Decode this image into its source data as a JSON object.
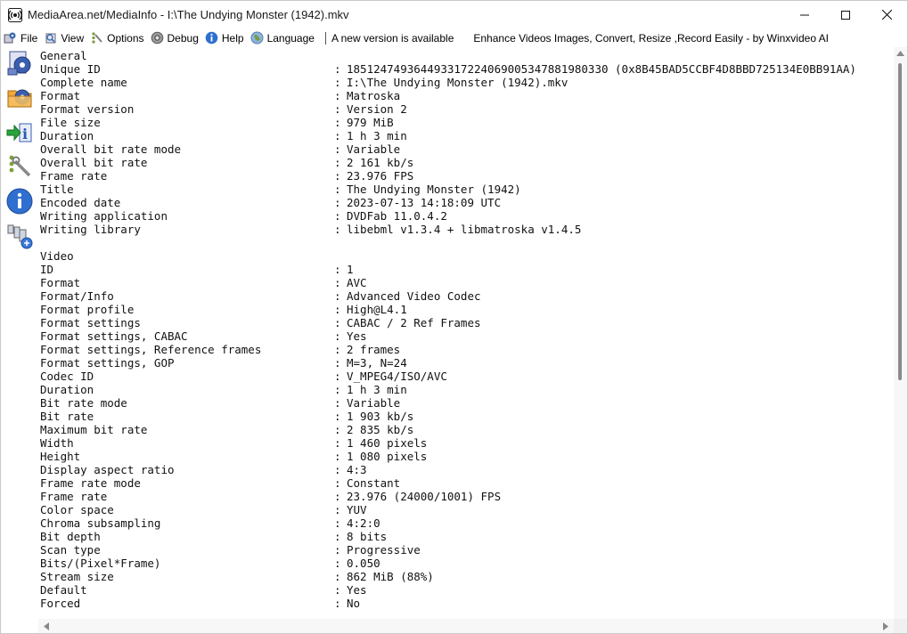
{
  "window": {
    "title": "MediaArea.net/MediaInfo - I:\\The Undying Monster (1942).mkv"
  },
  "menu": {
    "file": "File",
    "view": "View",
    "options": "Options",
    "debug": "Debug",
    "help": "Help",
    "language": "Language",
    "new_version": "A new version is available",
    "promo": "Enhance Videos  Images, Convert, Resize ,Record Easily - by Winxvideo AI"
  },
  "toolbar": {
    "icons": [
      "open-file-icon",
      "open-folder-icon",
      "export-icon",
      "preferences-icon",
      "about-icon",
      "knowledge-base-icon"
    ]
  },
  "general": {
    "heading": "General",
    "rows": [
      {
        "k": "Unique ID",
        "v": "185124749364493317224069005347881980330 (0x8B45BAD5CCBF4D8BBD725134E0BB91AA)"
      },
      {
        "k": "Complete name",
        "v": "I:\\The Undying Monster (1942).mkv"
      },
      {
        "k": "Format",
        "v": "Matroska"
      },
      {
        "k": "Format version",
        "v": "Version 2"
      },
      {
        "k": "File size",
        "v": "979 MiB"
      },
      {
        "k": "Duration",
        "v": "1 h 3 min"
      },
      {
        "k": "Overall bit rate mode",
        "v": "Variable"
      },
      {
        "k": "Overall bit rate",
        "v": "2 161 kb/s"
      },
      {
        "k": "Frame rate",
        "v": "23.976 FPS"
      },
      {
        "k": "Title",
        "v": "The Undying Monster (1942)"
      },
      {
        "k": "Encoded date",
        "v": "2023-07-13 14:18:09 UTC"
      },
      {
        "k": "Writing application",
        "v": "DVDFab 11.0.4.2"
      },
      {
        "k": "Writing library",
        "v": "libebml v1.3.4 + libmatroska v1.4.5"
      }
    ]
  },
  "video": {
    "heading": "Video",
    "rows": [
      {
        "k": "ID",
        "v": "1"
      },
      {
        "k": "Format",
        "v": "AVC"
      },
      {
        "k": "Format/Info",
        "v": "Advanced Video Codec"
      },
      {
        "k": "Format profile",
        "v": "High@L4.1"
      },
      {
        "k": "Format settings",
        "v": "CABAC / 2 Ref Frames"
      },
      {
        "k": "Format settings, CABAC",
        "v": "Yes"
      },
      {
        "k": "Format settings, Reference frames",
        "v": "2 frames"
      },
      {
        "k": "Format settings, GOP",
        "v": "M=3, N=24"
      },
      {
        "k": "Codec ID",
        "v": "V_MPEG4/ISO/AVC"
      },
      {
        "k": "Duration",
        "v": "1 h 3 min"
      },
      {
        "k": "Bit rate mode",
        "v": "Variable"
      },
      {
        "k": "Bit rate",
        "v": "1 903 kb/s"
      },
      {
        "k": "Maximum bit rate",
        "v": "2 835 kb/s"
      },
      {
        "k": "Width",
        "v": "1 460 pixels"
      },
      {
        "k": "Height",
        "v": "1 080 pixels"
      },
      {
        "k": "Display aspect ratio",
        "v": "4:3"
      },
      {
        "k": "Frame rate mode",
        "v": "Constant"
      },
      {
        "k": "Frame rate",
        "v": "23.976 (24000/1001) FPS"
      },
      {
        "k": "Color space",
        "v": "YUV"
      },
      {
        "k": "Chroma subsampling",
        "v": "4:2:0"
      },
      {
        "k": "Bit depth",
        "v": "8 bits"
      },
      {
        "k": "Scan type",
        "v": "Progressive"
      },
      {
        "k": "Bits/(Pixel*Frame)",
        "v": "0.050"
      },
      {
        "k": "Stream size",
        "v": "862 MiB (88%)"
      },
      {
        "k": "Default",
        "v": "Yes"
      },
      {
        "k": "Forced",
        "v": "No"
      }
    ]
  },
  "separator": ":"
}
